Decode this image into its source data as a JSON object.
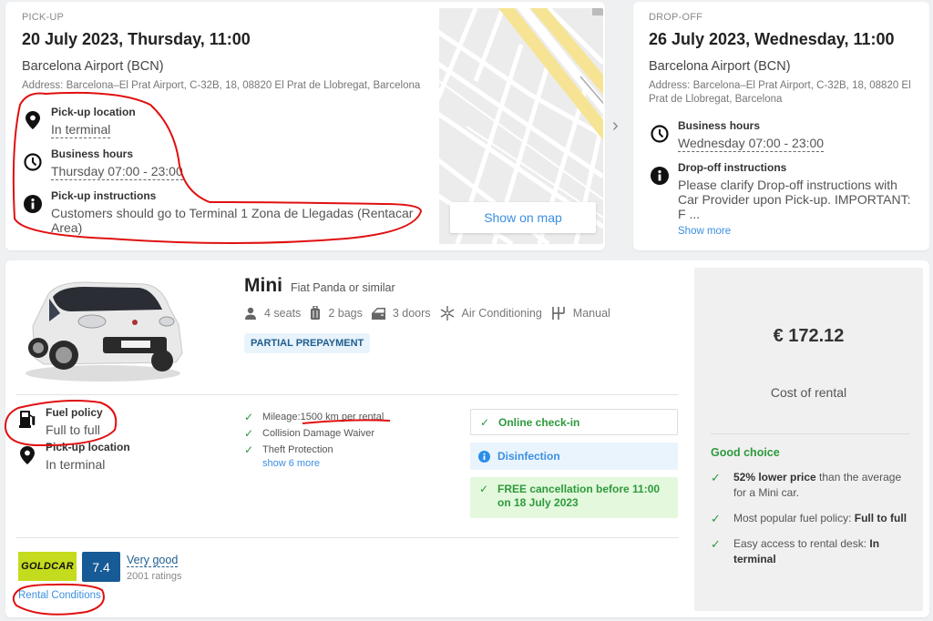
{
  "pickup": {
    "section_label": "PICK-UP",
    "datetime": "20 July 2023, Thursday, 11:00",
    "location_name": "Barcelona Airport (BCN)",
    "address": "Address: Barcelona–El Prat Airport, C-32B, 18, 08820 El Prat de Llobregat, Barcelona",
    "items": [
      {
        "icon": "location-pin-icon",
        "title": "Pick-up location",
        "value": "In terminal"
      },
      {
        "icon": "clock-icon",
        "title": "Business hours",
        "value": "Thursday 07:00 - 23:00"
      },
      {
        "icon": "info-icon",
        "title": "Pick-up instructions",
        "value": "Customers should go to Terminal 1 Zona de Llegadas (Rentacar Area)"
      }
    ],
    "map_button": "Show on map"
  },
  "carousel": {
    "next_icon": "chevron-right-icon",
    "next_glyph": "›"
  },
  "dropoff": {
    "section_label": "DROP-OFF",
    "datetime": "26 July 2023, Wednesday, 11:00",
    "location_name": "Barcelona Airport (BCN)",
    "address": "Address: Barcelona–El Prat Airport, C-32B, 18, 08820 El Prat de Llobregat, Barcelona",
    "items": [
      {
        "icon": "clock-icon",
        "title": "Business hours",
        "value": "Wednesday 07:00 - 23:00"
      },
      {
        "icon": "info-icon",
        "title": "Drop-off instructions",
        "value": "Please clarify Drop-off instructions with Car Provider upon Pick-up. IMPORTANT: F ..."
      }
    ],
    "show_more": "Show more"
  },
  "offer": {
    "category": "Mini",
    "model": "Fiat Panda or similar",
    "features": [
      {
        "icon": "person-icon",
        "label": "4 seats"
      },
      {
        "icon": "luggage-icon",
        "label": "2 bags"
      },
      {
        "icon": "car-door-icon",
        "label": "3 doors"
      },
      {
        "icon": "snowflake-icon",
        "label": "Air Conditioning"
      },
      {
        "icon": "gearbox-icon",
        "label": "Manual"
      }
    ],
    "badge": "PARTIAL PREPAYMENT",
    "fuel_policy": {
      "title": "Fuel policy",
      "value": "Full to full"
    },
    "pickup_location": {
      "title": "Pick-up location",
      "value": "In terminal"
    },
    "inclusions": [
      {
        "prefix": "Mileage: ",
        "value": "1500 km per rental"
      },
      {
        "prefix": "",
        "value": "Collision Damage Waiver"
      },
      {
        "prefix": "",
        "value": "Theft Protection"
      }
    ],
    "show_more_inclusions": "show 6 more",
    "perks": {
      "checkin": "Online check-in",
      "disinfection": "Disinfection",
      "cancellation": "FREE cancellation before 11:00 on 18 July 2023"
    },
    "supplier": {
      "name": "GOLDCAR",
      "score": "7.4",
      "rating_label": "Very good",
      "rating_count": "2001 ratings"
    },
    "rental_conditions": "Rental Conditions"
  },
  "price_panel": {
    "price": "€ 172.12",
    "caption": "Cost of rental",
    "good_choice_title": "Good choice",
    "reasons": [
      {
        "bold": "52% lower price",
        "rest": " than the average for a Mini car.",
        "bold_first": true
      },
      {
        "bold": "Full to full",
        "rest": "Most popular fuel policy: ",
        "bold_first": false
      },
      {
        "bold": "In terminal",
        "rest": "Easy access to rental desk: ",
        "bold_first": false
      }
    ]
  },
  "colors": {
    "accent_blue": "#3b8fe0",
    "green": "#2e9a3c",
    "score_blue": "#165b96",
    "goldcar_yellow": "#c5db1d",
    "annotation_red": "#e01010"
  }
}
